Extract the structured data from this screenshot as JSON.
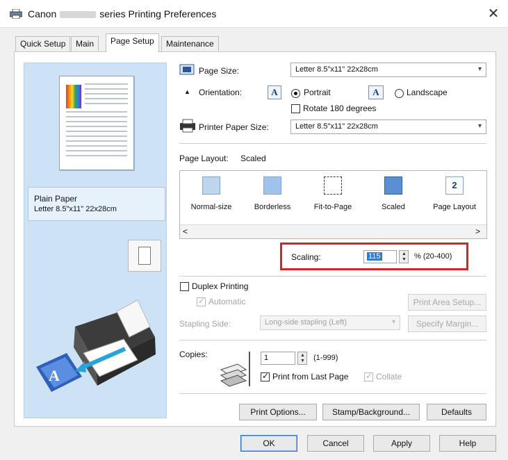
{
  "window": {
    "title_prefix": "Canon",
    "title_suffix": "series Printing Preferences",
    "close_glyph": "✕"
  },
  "tabs": [
    {
      "label": "Quick Setup",
      "active": false
    },
    {
      "label": "Main",
      "active": false
    },
    {
      "label": "Page Setup",
      "active": true
    },
    {
      "label": "Maintenance",
      "active": false
    }
  ],
  "preview": {
    "media_type": "Plain Paper",
    "media_size": "Letter 8.5\"x11\" 22x28cm"
  },
  "page_setup": {
    "page_size_label": "Page Size:",
    "page_size_value": "Letter 8.5\"x11\" 22x28cm",
    "orientation_label": "Orientation:",
    "portrait_label": "Portrait",
    "landscape_label": "Landscape",
    "orientation_selected": "Portrait",
    "rotate_label": "Rotate 180 degrees",
    "rotate_checked": false,
    "printer_paper_size_label": "Printer Paper Size:",
    "printer_paper_size_value": "Letter 8.5\"x11\" 22x28cm",
    "page_layout_label": "Page Layout:",
    "page_layout_value": "Scaled",
    "layouts": [
      {
        "label": "Normal-size",
        "icon": "normal-size-icon"
      },
      {
        "label": "Borderless",
        "icon": "borderless-icon"
      },
      {
        "label": "Fit-to-Page",
        "icon": "fit-to-page-icon"
      },
      {
        "label": "Scaled",
        "icon": "scaled-icon",
        "selected": true
      },
      {
        "label": "Page Layout",
        "icon": "page-layout-icon",
        "number": "2"
      }
    ],
    "scroll_left": "<",
    "scroll_right": ">",
    "scaling_label": "Scaling:",
    "scaling_value": "115",
    "scaling_range": "% (20-400)"
  },
  "duplex": {
    "duplex_label": "Duplex Printing",
    "duplex_checked": false,
    "automatic_label": "Automatic",
    "automatic_checked": true,
    "print_area_button": "Print Area Setup...",
    "stapling_label": "Stapling Side:",
    "stapling_value": "Long-side stapling (Left)",
    "specify_margin_button": "Specify Margin..."
  },
  "copies": {
    "copies_label": "Copies:",
    "copies_value": "1",
    "copies_range": "(1-999)",
    "print_from_last_label": "Print from Last Page",
    "print_from_last_checked": true,
    "collate_label": "Collate",
    "collate_checked": true
  },
  "bottom_buttons": {
    "print_options": "Print Options...",
    "stamp_background": "Stamp/Background...",
    "defaults": "Defaults"
  },
  "dialog_buttons": {
    "ok": "OK",
    "cancel": "Cancel",
    "apply": "Apply",
    "help": "Help"
  },
  "colors": {
    "preview_bg": "#cde3f5",
    "highlight": "#e02020",
    "selection": "#2c7bd6"
  }
}
